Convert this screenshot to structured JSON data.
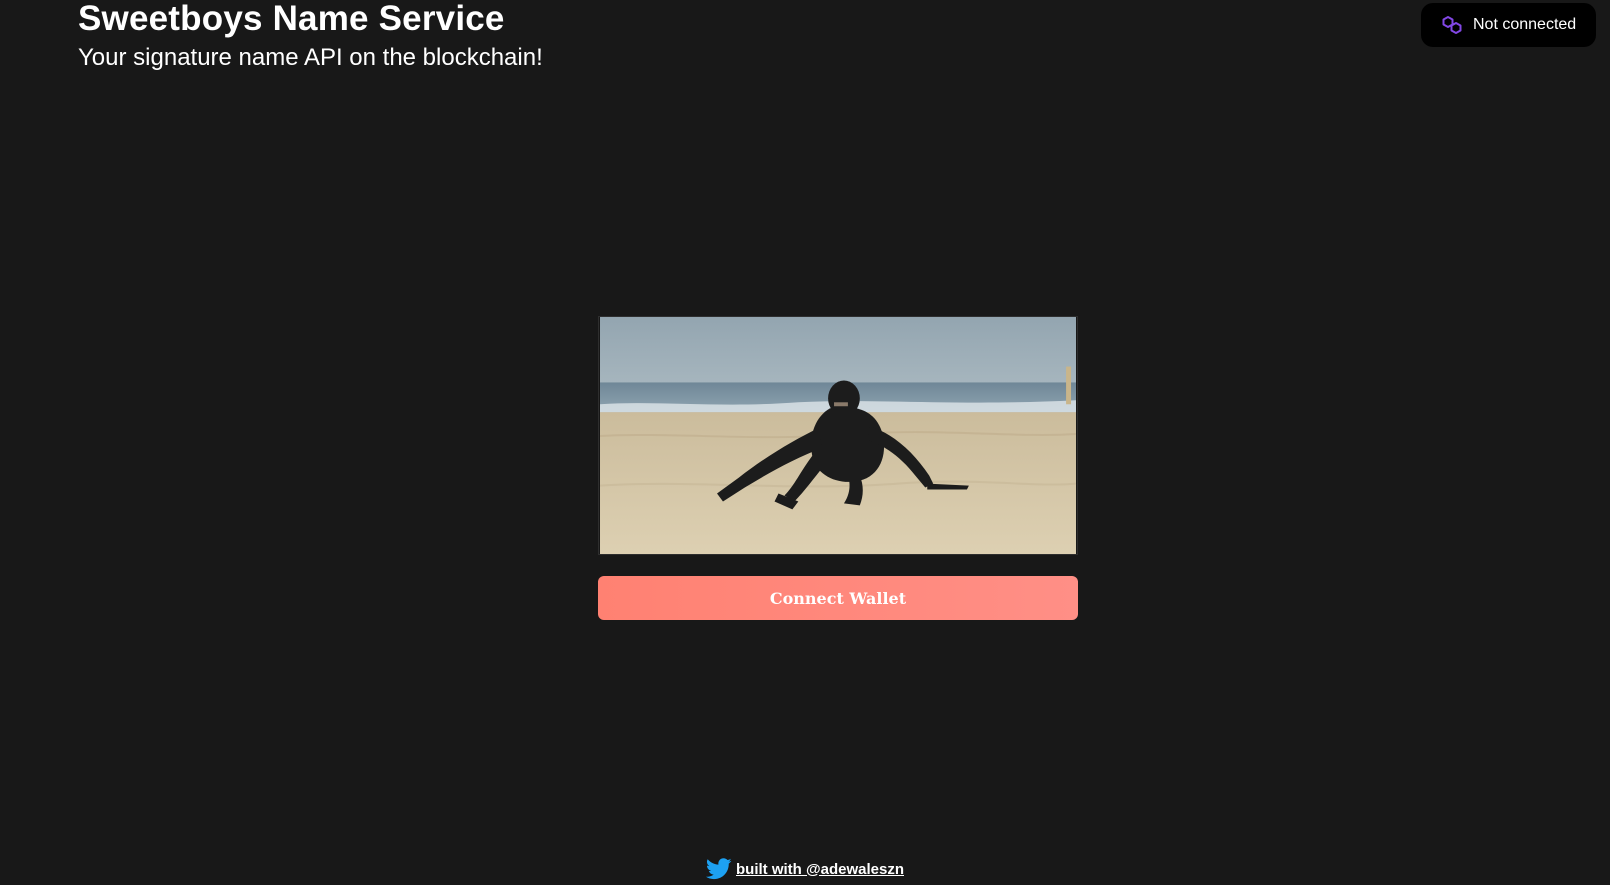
{
  "header": {
    "title": "Sweetboys Name Service",
    "subtitle": "Your signature name API on the blockchain!"
  },
  "network": {
    "status": "Not connected",
    "icon": "polygon-icon",
    "icon_color": "#8247e5"
  },
  "hero": {
    "alt": "ninja crouching on a beach"
  },
  "actions": {
    "connect_label": "Connect Wallet",
    "connect_color": "#ff8a7d"
  },
  "footer": {
    "icon": "twitter-icon",
    "icon_color": "#1da1f2",
    "link_text": "built with @adewaleszn"
  },
  "colors": {
    "background": "#181818",
    "text": "#ffffff"
  }
}
